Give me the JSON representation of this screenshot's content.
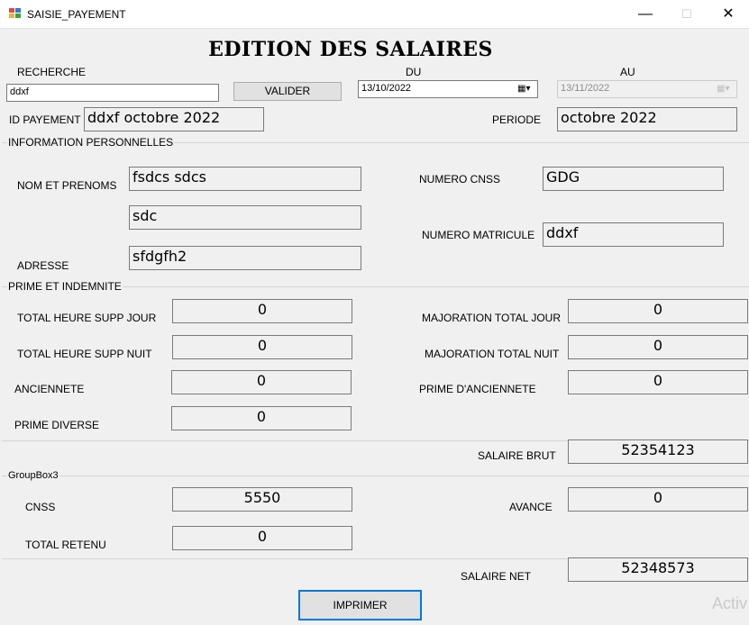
{
  "window": {
    "title": "SAISIE_PAYEMENT",
    "minimize": "—",
    "maximize": "☐",
    "close": "✕"
  },
  "page_title": "EDITION DES SALAIRES",
  "search": {
    "label": "RECHERCHE",
    "value": "ddxf",
    "button": "VALIDER"
  },
  "dates": {
    "from_label": "DU",
    "from_value": "13/10/2022",
    "to_label": "AU",
    "to_value": "13/11/2022",
    "calendar_icon": "▦▾"
  },
  "id_payement": {
    "label": "ID PAYEMENT",
    "value": "ddxf octobre 2022"
  },
  "periode": {
    "label": "PERIODE",
    "value": "octobre 2022"
  },
  "personal": {
    "group_label": "INFORMATION PERSONNELLES",
    "name_label": "NOM ET PRENOMS",
    "nom": "fsdcs sdcs",
    "prenoms": "sdc",
    "adresse_label": "ADRESSE",
    "adresse": "sfdgfh2",
    "cnss_label": "NUMERO CNSS",
    "cnss": "GDG",
    "matricule_label": "NUMERO MATRICULE",
    "matricule": "ddxf"
  },
  "primes": {
    "group_label": "PRIME ET INDEMNITE",
    "hs_jour_label": "TOTAL HEURE SUPP JOUR",
    "hs_jour": "0",
    "hs_nuit_label": "TOTAL HEURE SUPP NUIT",
    "hs_nuit": "0",
    "anciennete_label": "ANCIENNETE",
    "anciennete": "0",
    "prime_diverse_label": "PRIME DIVERSE",
    "prime_diverse": "0",
    "maj_jour_label": "MAJORATION TOTAL JOUR",
    "maj_jour": "0",
    "maj_nuit_label": "MAJORATION TOTAL NUIT",
    "maj_nuit": "0",
    "prime_anc_label": "PRIME D'ANCIENNETE",
    "prime_anc": "0"
  },
  "salaire_brut": {
    "label": "SALAIRE BRUT",
    "value": "52354123"
  },
  "retenues": {
    "group_label": "GroupBox3",
    "cnss_label": "CNSS",
    "cnss": "5550",
    "total_label": "TOTAL RETENU",
    "total": "0",
    "avance_label": "AVANCE",
    "avance": "0"
  },
  "salaire_net": {
    "label": "SALAIRE NET",
    "value": "52348573"
  },
  "print_button": "IMPRIMER",
  "watermark": "Activ",
  "colors": {
    "accent": "#0078d7",
    "background": "#f0f0f0"
  }
}
